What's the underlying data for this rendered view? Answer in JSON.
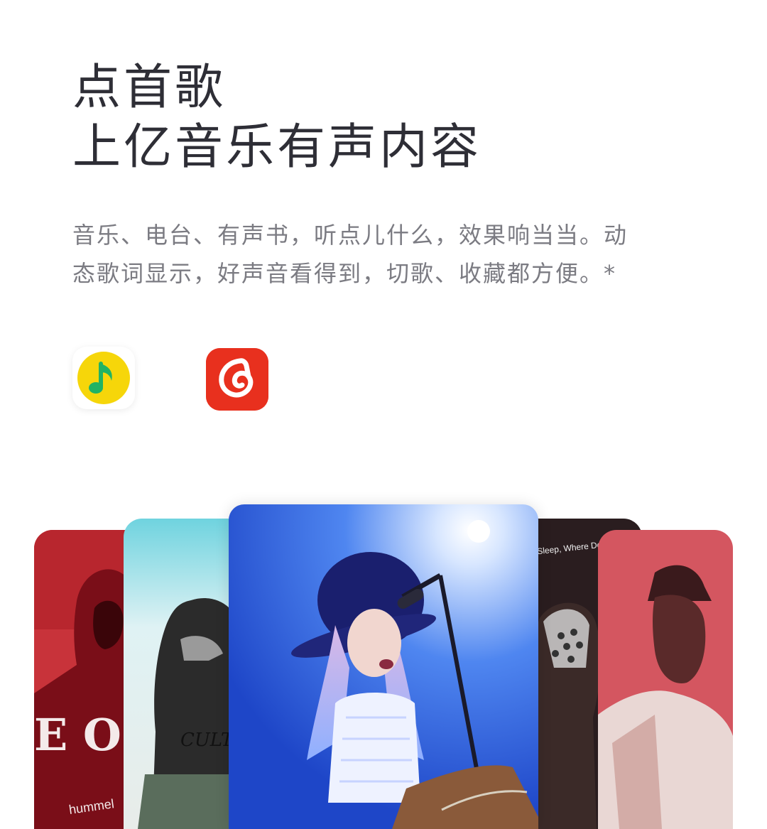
{
  "headline": {
    "line1": "点首歌",
    "line2": "上亿音乐有声内容"
  },
  "description": {
    "line1": "音乐、电台、有声书，听点儿什么，效果响当当。动",
    "line2": "态歌词显示，好声音看得到，切歌、收藏都方便。*"
  },
  "app_icons": [
    {
      "icon": "qq-music-icon",
      "color": "#f6d60a",
      "accent": "#21b364"
    },
    {
      "icon": "netease-cloud-music-icon",
      "color": "#e8301e"
    }
  ],
  "cards": [
    {
      "icon": "album-art-red-hoodie",
      "color": "#c8333a"
    },
    {
      "icon": "album-art-monochrome-portrait",
      "color": "#6fd3df"
    },
    {
      "icon": "concert-singer-photo",
      "color": "#3f6ee8"
    },
    {
      "icon": "album-art-dark-portrait",
      "color": "#2a1d1f",
      "caption": "Sleep, Where Do We Go?"
    },
    {
      "icon": "album-art-man-hat",
      "color": "#d45660"
    }
  ]
}
